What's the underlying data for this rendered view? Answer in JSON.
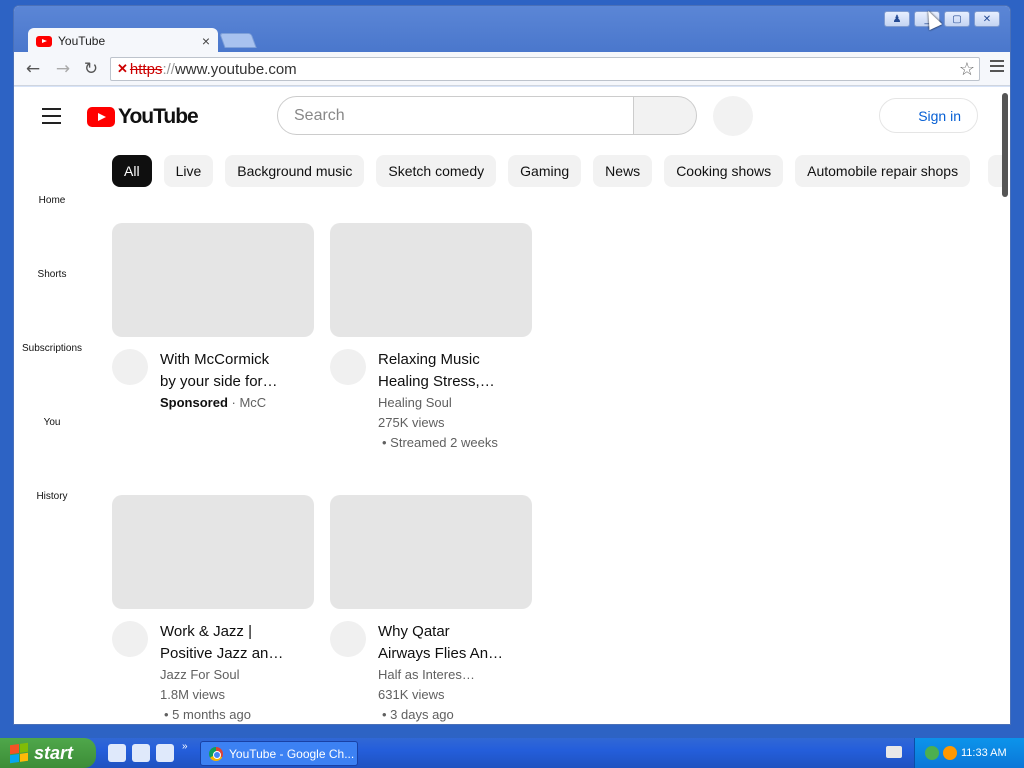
{
  "browser": {
    "tab_title": "YouTube",
    "tab_close": "×",
    "url_scheme": "https",
    "url_sep": "://",
    "url_host": "www.youtube.com",
    "window_controls": [
      "♟",
      "▢",
      "✕"
    ]
  },
  "youtube": {
    "logo_text": "YouTube",
    "search_placeholder": "Search",
    "signin_label": "Sign in",
    "left_nav": [
      "Home",
      "Shorts",
      "Subscriptions",
      "You",
      "History"
    ],
    "chips": [
      "All",
      "Live",
      "Background music",
      "Sketch comedy",
      "Gaming",
      "News",
      "Cooking shows",
      "Automobile repair shops"
    ],
    "videos": [
      {
        "title_line1": "With McCormick",
        "title_line2": "by your side for…",
        "sponsored": "Sponsored",
        "channel": "· McC",
        "views": "",
        "age": ""
      },
      {
        "title_line1": "Relaxing Music",
        "title_line2": "Healing Stress,…",
        "sponsored": "",
        "channel": "Healing Soul",
        "views": "275K views",
        "age": "• Streamed 2 weeks"
      },
      {
        "title_line1": "Work & Jazz |",
        "title_line2": "Positive Jazz an…",
        "sponsored": "",
        "channel": "Jazz For Soul",
        "views": "1.8M views",
        "age": "• 5 months ago"
      },
      {
        "title_line1": "Why Qatar",
        "title_line2": "Airways Flies An…",
        "sponsored": "",
        "channel": "Half as Interes…",
        "views": "631K views",
        "age": "• 3 days ago"
      }
    ]
  },
  "taskbar": {
    "start_label": "start",
    "task_label": "YouTube - Google Ch...",
    "more": "»",
    "clock": "11:33 AM"
  }
}
